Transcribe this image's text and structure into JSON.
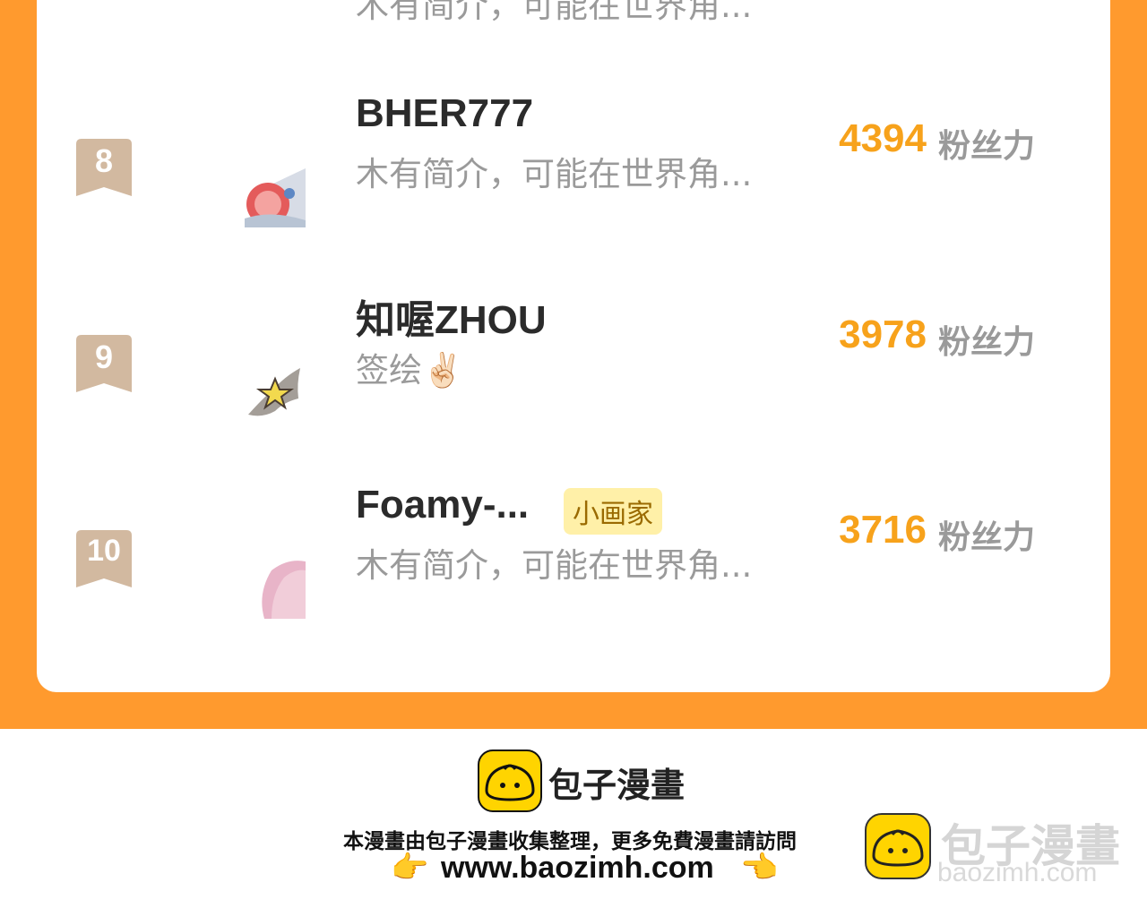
{
  "cut_row": {
    "desc": "木有简介，可能在世界角..."
  },
  "rows": [
    {
      "rank": "8",
      "name": "BHER777",
      "desc": "木有简介，可能在世界角...",
      "score": "4394",
      "unit": "粉丝力",
      "badge": ""
    },
    {
      "rank": "9",
      "name": "知喔ZHOU",
      "desc": "签绘✌🏻",
      "score": "3978",
      "unit": "粉丝力",
      "badge": ""
    },
    {
      "rank": "10",
      "name": "Foamy-...",
      "desc": "木有简介，可能在世界角...",
      "score": "3716",
      "unit": "粉丝力",
      "badge": "小画家"
    }
  ],
  "footer": {
    "brand": "包子漫畫",
    "note": "本漫畫由包子漫畫收集整理，更多免費漫畫請訪問",
    "url": "www.baozimh.com",
    "hand_left": "👉",
    "hand_right": "👈"
  },
  "watermark": {
    "brand": "包子漫畫",
    "url": "baozimh.com"
  },
  "colors": {
    "orange": "#FF9A2E",
    "score": "#F7A21B",
    "rank_tag": "#D2B9A0",
    "badge_bg": "#FFF0A8"
  },
  "icons": {
    "logo": "baozi-bun-icon",
    "rank": "bookmark-ribbon-icon"
  }
}
